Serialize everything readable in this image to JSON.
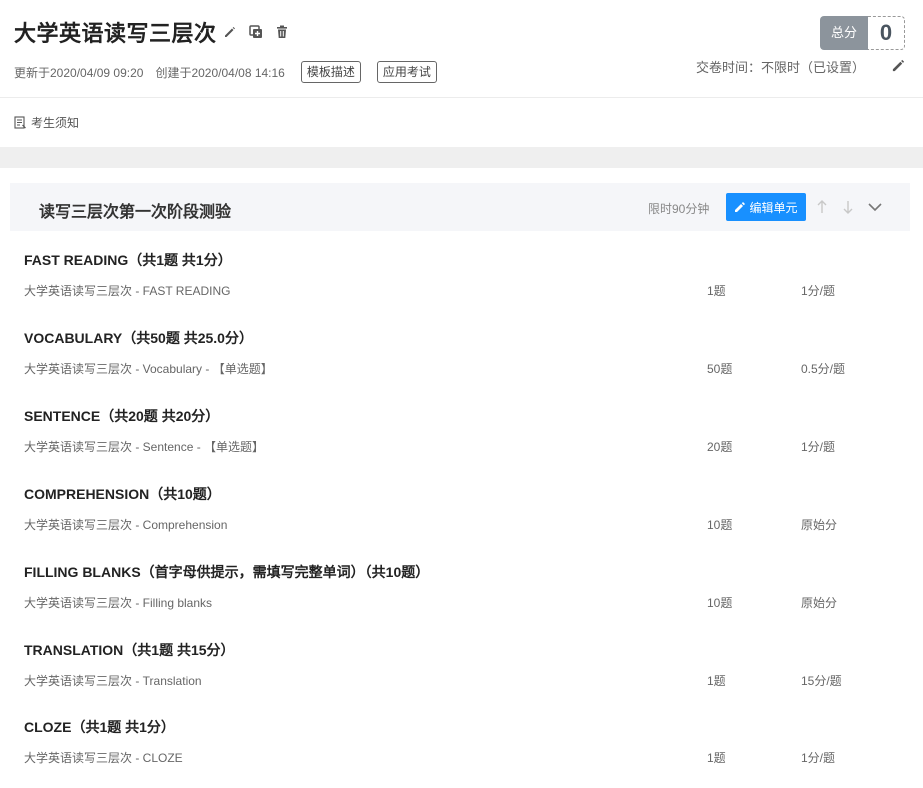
{
  "header": {
    "title": "大学英语读写三层次",
    "updated": "更新于2020/04/09 09:20",
    "created": "创建于2020/04/08 14:16",
    "tag_template": "模板描述",
    "tag_apply": "应用考试",
    "score_label": "总分",
    "score_value": "0",
    "deadline": "交卷时间：不限时（已设置）"
  },
  "notice": {
    "label": "考生须知"
  },
  "unit": {
    "title": "读写三层次第一次阶段测验",
    "time_limit": "限时90分钟",
    "edit_label": "编辑单元"
  },
  "sections": [
    {
      "title": "FAST READING（共1题 共1分）",
      "source": "大学英语读写三层次  - FAST READING",
      "count": "1题",
      "score": "1分/题"
    },
    {
      "title": "VOCABULARY（共50题 共25.0分）",
      "source": "大学英语读写三层次  - Vocabulary  - 【单选题】",
      "count": "50题",
      "score": "0.5分/题"
    },
    {
      "title": "SENTENCE（共20题 共20分）",
      "source": "大学英语读写三层次  - Sentence  - 【单选题】",
      "count": "20题",
      "score": "1分/题"
    },
    {
      "title": "COMPREHENSION（共10题）",
      "source": "大学英语读写三层次  - Comprehension",
      "count": "10题",
      "score": "原始分"
    },
    {
      "title": "FILLING BLANKS（首字母供提示，需填写完整单词）（共10题）",
      "source": "大学英语读写三层次  - Filling blanks",
      "count": "10题",
      "score": "原始分"
    },
    {
      "title": "TRANSLATION（共1题 共15分）",
      "source": "大学英语读写三层次  - Translation",
      "count": "1题",
      "score": "15分/题"
    },
    {
      "title": "CLOZE（共1题 共1分）",
      "source": "大学英语读写三层次  - CLOZE",
      "count": "1题",
      "score": "1分/题"
    }
  ]
}
